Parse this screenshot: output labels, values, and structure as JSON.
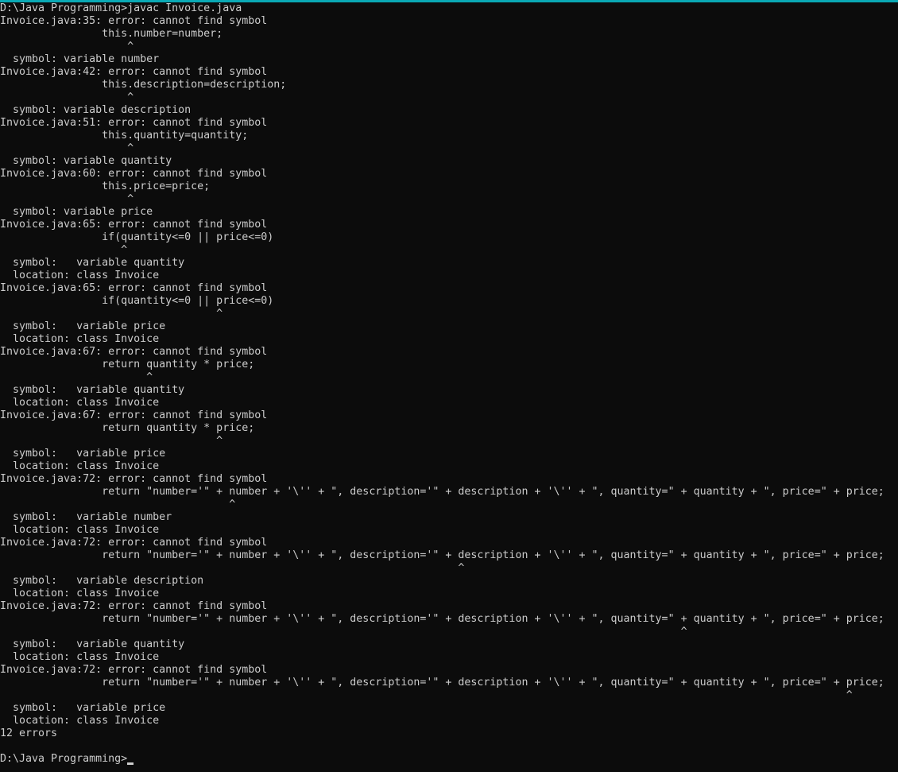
{
  "colors": {
    "background": "#0c0c0c",
    "foreground": "#cccccc",
    "accent": "#0aa9b5"
  },
  "terminal": {
    "lines": [
      "D:\\Java Programming>javac Invoice.java",
      "Invoice.java:35: error: cannot find symbol",
      "                this.number=number;",
      "                    ^",
      "  symbol: variable number",
      "Invoice.java:42: error: cannot find symbol",
      "                this.description=description;",
      "                    ^",
      "  symbol: variable description",
      "Invoice.java:51: error: cannot find symbol",
      "                this.quantity=quantity;",
      "                    ^",
      "  symbol: variable quantity",
      "Invoice.java:60: error: cannot find symbol",
      "                this.price=price;",
      "                    ^",
      "  symbol: variable price",
      "Invoice.java:65: error: cannot find symbol",
      "                if(quantity<=0 || price<=0)",
      "                   ^",
      "  symbol:   variable quantity",
      "  location: class Invoice",
      "Invoice.java:65: error: cannot find symbol",
      "                if(quantity<=0 || price<=0)",
      "                                  ^",
      "  symbol:   variable price",
      "  location: class Invoice",
      "Invoice.java:67: error: cannot find symbol",
      "                return quantity * price;",
      "                       ^",
      "  symbol:   variable quantity",
      "  location: class Invoice",
      "Invoice.java:67: error: cannot find symbol",
      "                return quantity * price;",
      "                                  ^",
      "  symbol:   variable price",
      "  location: class Invoice",
      "Invoice.java:72: error: cannot find symbol",
      "                return \"number='\" + number + '\\'' + \", description='\" + description + '\\'' + \", quantity=\" + quantity + \", price=\" + price;",
      "                                    ^",
      "  symbol:   variable number",
      "  location: class Invoice",
      "Invoice.java:72: error: cannot find symbol",
      "                return \"number='\" + number + '\\'' + \", description='\" + description + '\\'' + \", quantity=\" + quantity + \", price=\" + price;",
      "                                                                        ^",
      "  symbol:   variable description",
      "  location: class Invoice",
      "Invoice.java:72: error: cannot find symbol",
      "                return \"number='\" + number + '\\'' + \", description='\" + description + '\\'' + \", quantity=\" + quantity + \", price=\" + price;",
      "                                                                                                           ^",
      "  symbol:   variable quantity",
      "  location: class Invoice",
      "Invoice.java:72: error: cannot find symbol",
      "                return \"number='\" + number + '\\'' + \", description='\" + description + '\\'' + \", quantity=\" + quantity + \", price=\" + price;",
      "                                                                                                                                     ^",
      "  symbol:   variable price",
      "  location: class Invoice",
      "12 errors",
      ""
    ],
    "prompt": "D:\\Java Programming>"
  }
}
